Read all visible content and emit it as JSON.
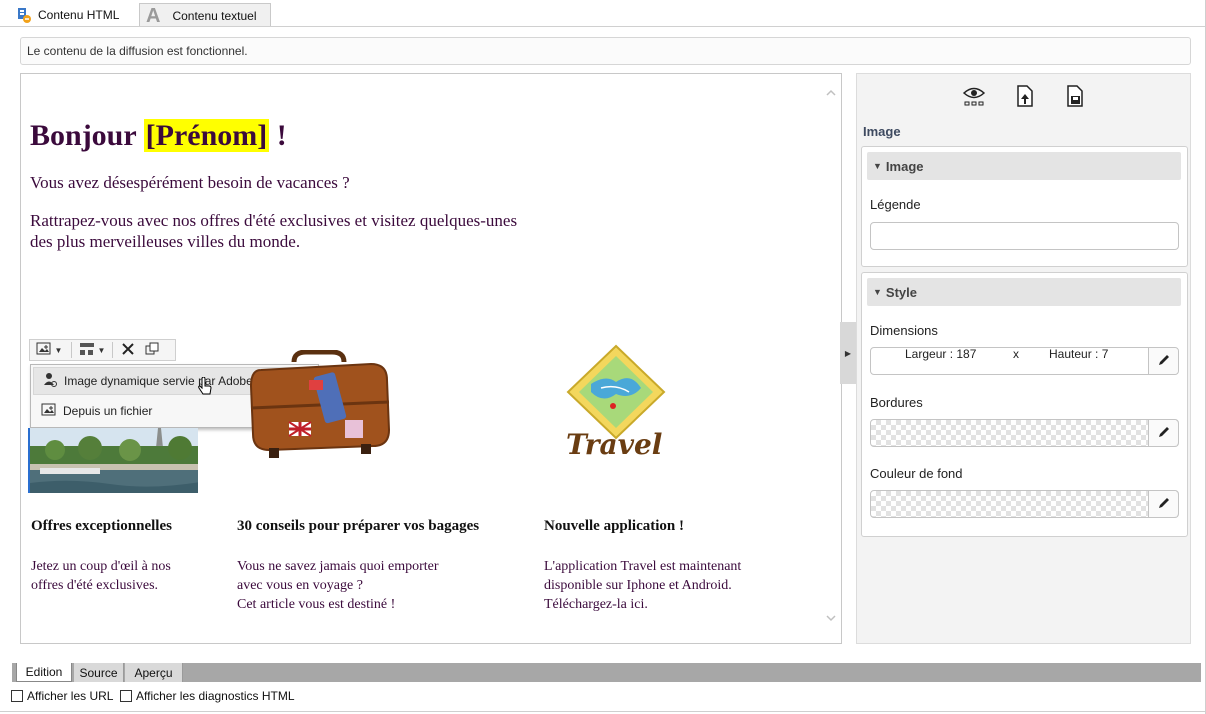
{
  "top_tabs": [
    {
      "label": "Contenu HTML",
      "icon": "html-content-icon",
      "active": true
    },
    {
      "label": "Contenu textuel",
      "icon": "text-content-icon",
      "active": false
    }
  ],
  "status": {
    "message": "Le contenu de la diffusion est fonctionnel."
  },
  "editor": {
    "greeting_prefix": "Bonjour ",
    "greeting_field": "[Prénom]",
    "greeting_suffix": " !",
    "line1": "Vous avez désespérément besoin de vacances ?",
    "line2a": "Rattrapez-vous avec nos offres d'été exclusives et visitez quelques-unes",
    "line2b": "des plus merveilleuses villes du monde.",
    "toolbar": {
      "buttons": [
        "insert-image-icon",
        "dropdown-arrow-icon",
        "layout-icon",
        "dropdown-arrow-icon",
        "delete-icon",
        "duplicate-icon"
      ]
    },
    "dropdown": {
      "items": [
        {
          "label": "Image dynamique servie par Adobe Target",
          "icon": "dynamic-image-icon"
        },
        {
          "label": "Depuis un fichier",
          "icon": "image-file-icon"
        }
      ]
    },
    "logo_text": "Travel",
    "columns": [
      {
        "title": "Offres exceptionnelles",
        "lines": [
          "Jetez un coup d'œil à nos",
          "offres d'été exclusives."
        ]
      },
      {
        "title": "30 conseils pour préparer vos bagages",
        "lines": [
          "Vous ne savez jamais quoi emporter",
          "avec vous en voyage ?",
          "Cet article vous est destiné !"
        ]
      },
      {
        "title": "Nouvelle application !",
        "lines": [
          "L'application Travel est maintenant",
          "disponible sur Iphone et Android.",
          "Téléchargez-la ici."
        ]
      }
    ]
  },
  "right_panel": {
    "icons": [
      "preview-icon",
      "upload-icon",
      "save-icon"
    ],
    "title": "Image",
    "image_section": {
      "header": "Image",
      "legend_label": "Légende",
      "legend_value": ""
    },
    "style_section": {
      "header": "Style",
      "dimensions_label": "Dimensions",
      "width_label": "Largeur : 187",
      "times": "x",
      "height_label": "Hauteur : 7",
      "borders_label": "Bordures",
      "bg_label": "Couleur de fond"
    }
  },
  "bottom_tabs": [
    {
      "label": "Edition",
      "active": true
    },
    {
      "label": "Source",
      "active": false
    },
    {
      "label": "Aperçu",
      "active": false
    }
  ],
  "checkboxes": [
    {
      "label": "Afficher les URL",
      "checked": false
    },
    {
      "label": "Afficher les diagnostics HTML",
      "checked": false
    }
  ],
  "colors": {
    "highlight": "#ffff00",
    "text_purple": "#3b0a3c",
    "panel_title": "#3e4a60"
  }
}
